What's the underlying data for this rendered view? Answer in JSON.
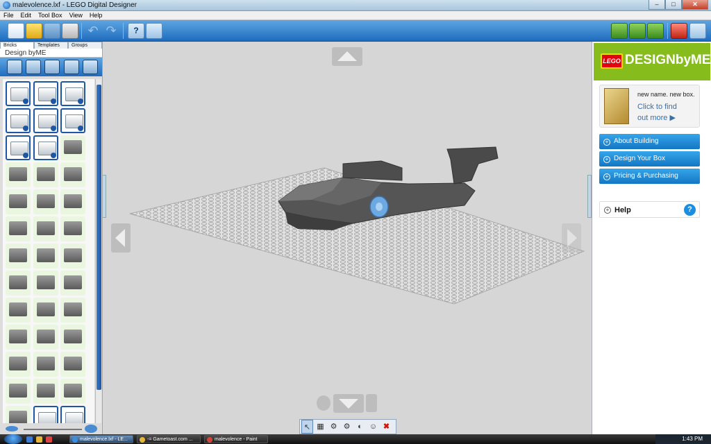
{
  "window": {
    "title": "malevolence.lxf - LEGO Digital Designer",
    "min_label": "–",
    "max_label": "□",
    "close_label": "✕"
  },
  "menu": [
    "File",
    "Edit",
    "Tool Box",
    "View",
    "Help"
  ],
  "toolbar": {
    "undo_icon": "↶",
    "redo_icon": "↷",
    "help_label": "?"
  },
  "left_panel": {
    "tabs": [
      "Bricks",
      "Templates",
      "Groups"
    ],
    "heading": "Design byME"
  },
  "right_panel": {
    "lego_logo": "LEGO",
    "brand": "DESIGNbyME",
    "promo": {
      "line1": "new name. new box.",
      "line2": "Click to find",
      "line3": "out more ▶"
    },
    "links": [
      "About Building",
      "Design Your Box",
      "Pricing & Purchasing"
    ],
    "help_label": "Help",
    "help_icon": "?",
    "plus_glyph": "+"
  },
  "bottom_tools": {
    "glyphs": [
      "↖",
      "▦",
      "⚙",
      "⚙",
      "◐",
      "☺",
      "✖"
    ]
  },
  "taskbar": {
    "tasks": [
      "malevolence.lxf - LE...",
      "-= Gametoast.com ...",
      "malevolence - Paint"
    ],
    "clock": "1:43 PM"
  },
  "colors": {
    "accent_blue": "#1f6cbf",
    "designbyme_green": "#86bd1c",
    "lego_red": "#e3000f",
    "link_blue": "#1476c3",
    "brick_gray": "#5a5a5a"
  }
}
